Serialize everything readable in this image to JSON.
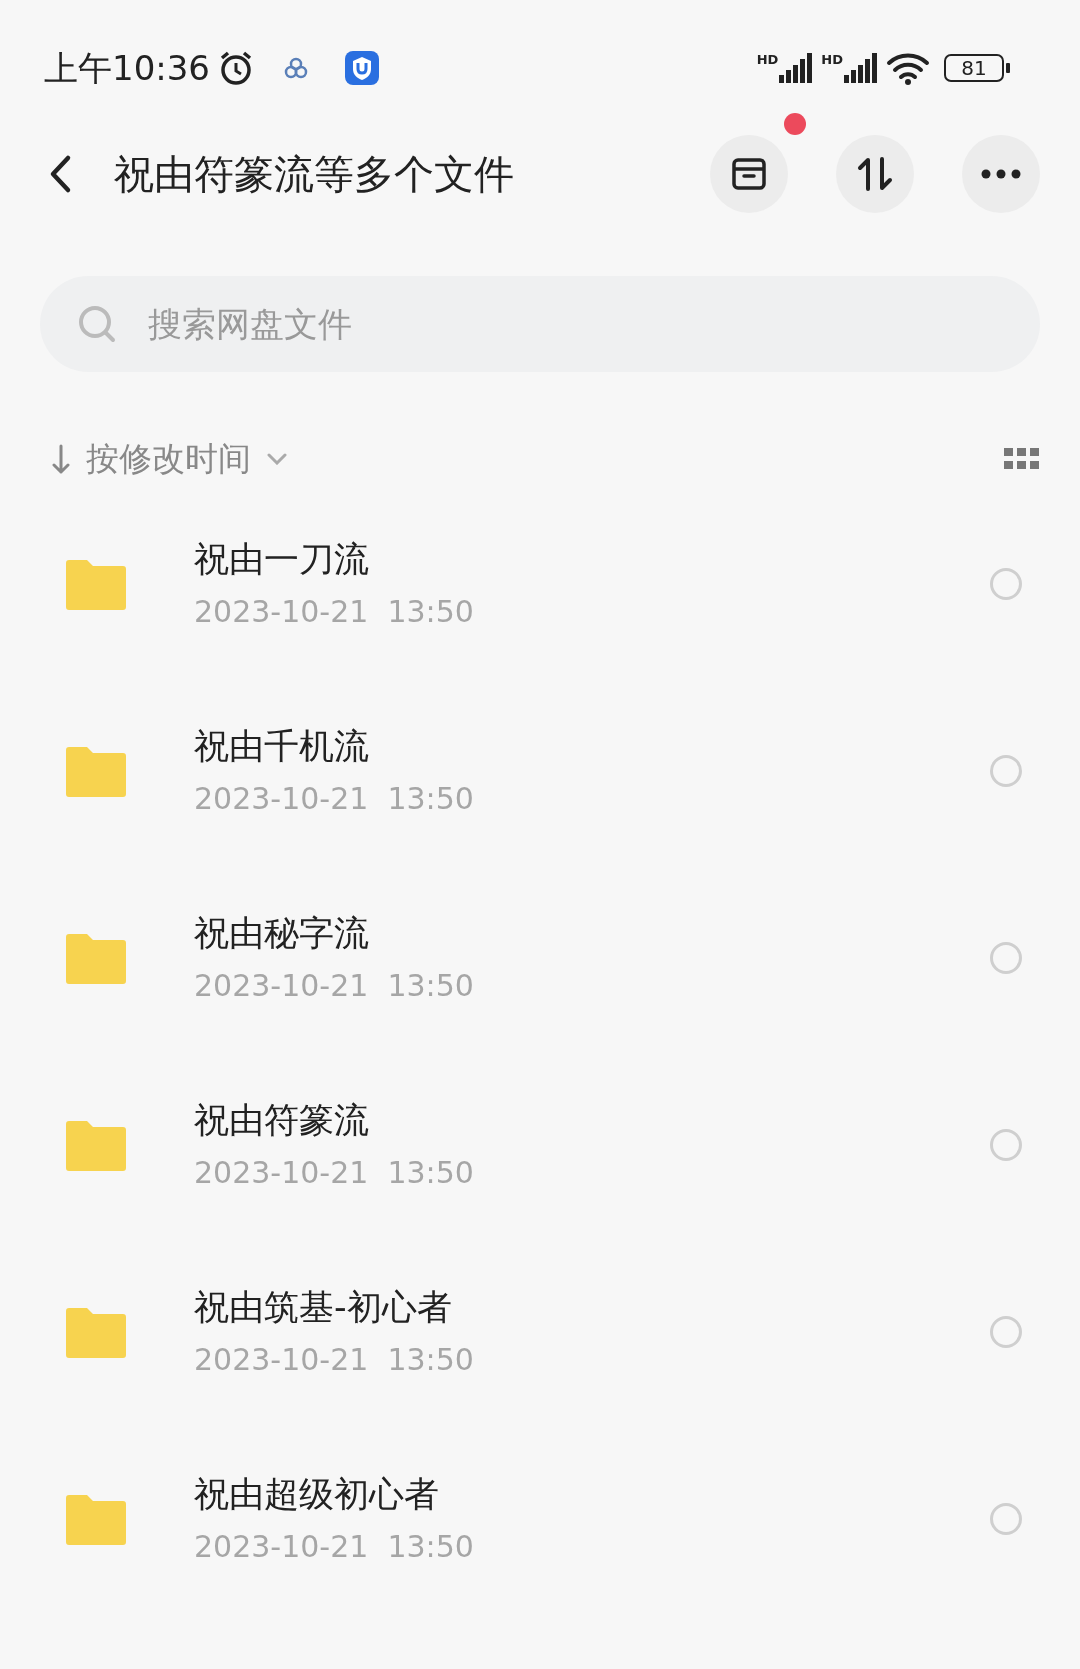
{
  "status_bar": {
    "time": "上午10:36",
    "signal_labels": [
      "HD",
      "HD"
    ],
    "battery": "81"
  },
  "header": {
    "title": "祝由符篆流等多个文件",
    "notification_dot": true
  },
  "search": {
    "placeholder": "搜索网盘文件"
  },
  "sort": {
    "label": "按修改时间"
  },
  "files": [
    {
      "name": "祝由一刀流",
      "modified": "2023-10-21  13:50",
      "selected": false
    },
    {
      "name": "祝由千机流",
      "modified": "2023-10-21  13:50",
      "selected": false
    },
    {
      "name": "祝由秘字流",
      "modified": "2023-10-21  13:50",
      "selected": false
    },
    {
      "name": "祝由符篆流",
      "modified": "2023-10-21  13:50",
      "selected": false
    },
    {
      "name": "祝由筑基-初心者",
      "modified": "2023-10-21  13:50",
      "selected": false
    },
    {
      "name": "祝由超级初心者",
      "modified": "2023-10-21  13:50",
      "selected": false
    }
  ]
}
